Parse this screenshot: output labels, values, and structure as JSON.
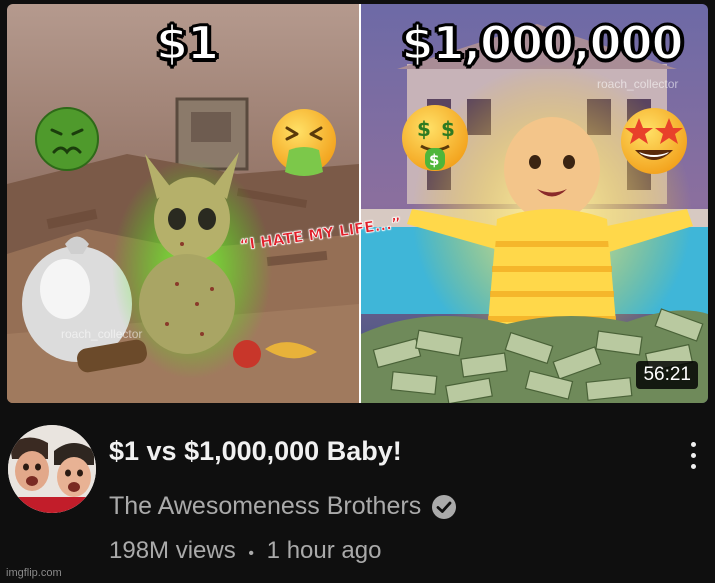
{
  "thumbnail": {
    "left_label": "$1",
    "right_label": "$1,000,000",
    "quote": "“I HATE MY LIFE...”",
    "watermark": "roach_collector",
    "duration": "56:21",
    "emojis": [
      "nauseated-face",
      "vomiting-face",
      "money-mouth-face",
      "star-struck-face"
    ]
  },
  "video": {
    "title": "$1 vs $1,000,000 Baby!",
    "channel": "The Awesomeness Brothers",
    "views": "198M views",
    "separator": "•",
    "age": "1 hour ago"
  },
  "footer": {
    "watermark": "imgflip.com"
  }
}
